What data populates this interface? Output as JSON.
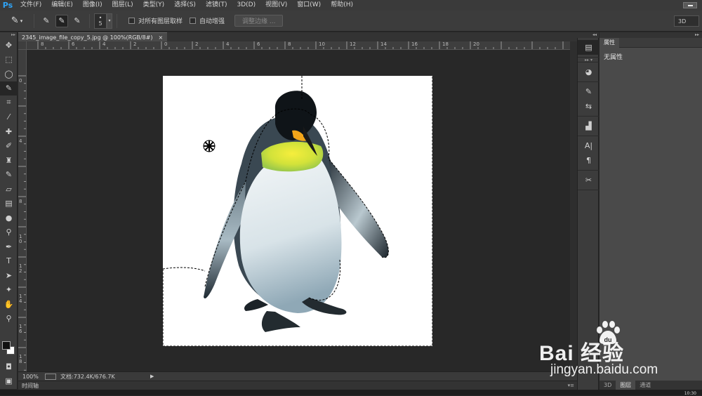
{
  "app": {
    "logo": "Ps"
  },
  "menu": [
    "文件(F)",
    "编辑(E)",
    "图像(I)",
    "图层(L)",
    "类型(Y)",
    "选择(S)",
    "滤镜(T)",
    "3D(D)",
    "视图(V)",
    "窗口(W)",
    "帮助(H)"
  ],
  "options": {
    "brush_size": "5",
    "sample_all_layers": {
      "label": "对所有图层取样",
      "checked": false
    },
    "auto_enhance": {
      "label": "自动增强",
      "checked": false
    },
    "refine_edge": "调整边缘 ...",
    "workspace": "3D"
  },
  "document": {
    "tab_title": "2345_image_file_copy_5.jpg @ 100%(RGB/8#)",
    "close": "×",
    "ruler_top": [
      "8",
      "6",
      "4",
      "2",
      "0",
      "2",
      "4",
      "6",
      "8",
      "10",
      "12",
      "14",
      "16",
      "18",
      "20"
    ],
    "ruler_left": [
      "0",
      "2",
      "4",
      "6",
      "8",
      "1 0",
      "1 2",
      "1 4",
      "1 6",
      "1 8"
    ]
  },
  "status": {
    "zoom": "100%",
    "doc_info": "文档:732.4K/676.7K",
    "arrow": "▶"
  },
  "timeline": {
    "label": "时间轴",
    "menu": "▾≡"
  },
  "properties": {
    "tab": "属性",
    "empty_text": "无属性"
  },
  "bottom_tabs": [
    "3D",
    "图层",
    "通道"
  ],
  "clock": "10:30",
  "watermark": {
    "brand": "Bai  经验",
    "url": "jingyan.baidu.com"
  },
  "colors": {
    "accent": "#2fa3f5",
    "ui_dark": "#282828",
    "panel": "#3c3c3c"
  }
}
